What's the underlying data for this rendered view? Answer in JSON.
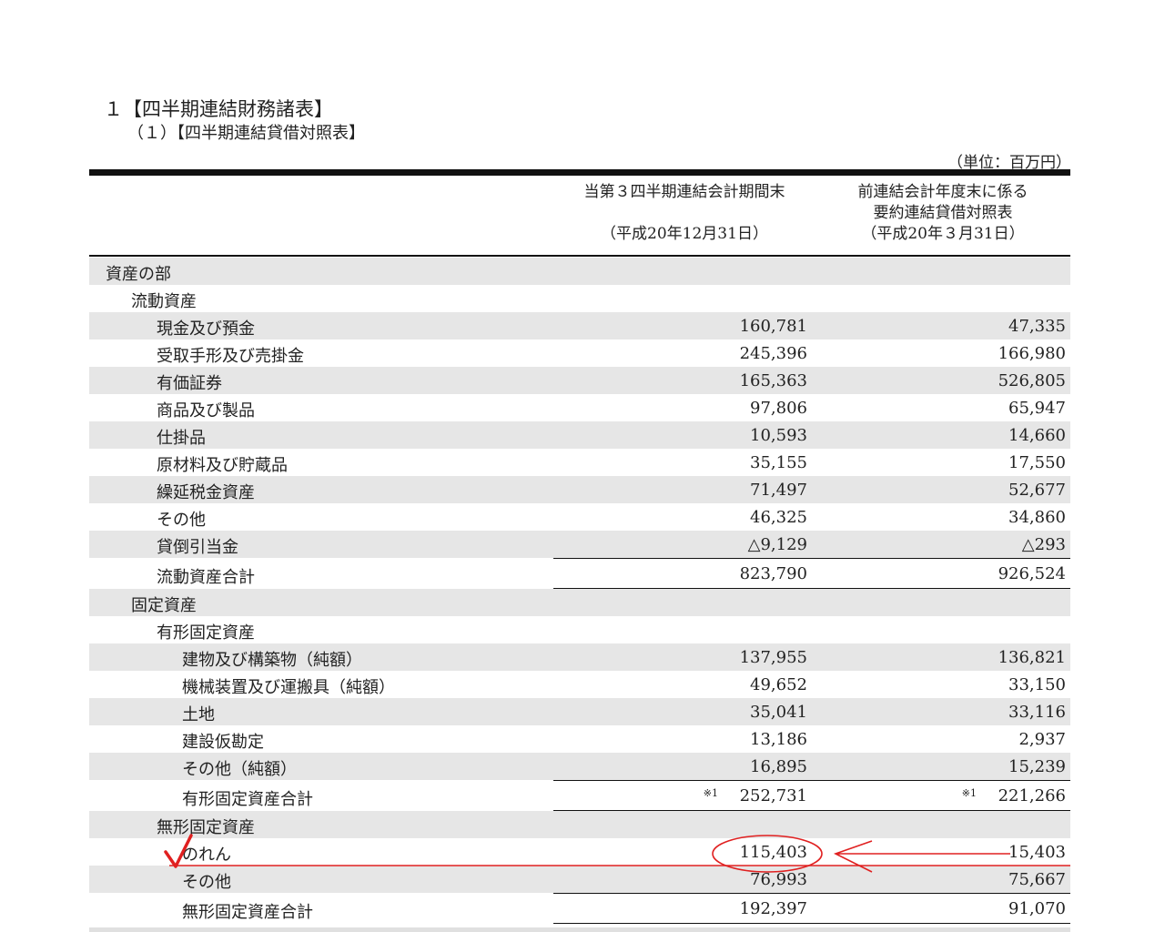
{
  "title": "１【四半期連結財務諸表】",
  "subtitle": "（１）【四半期連結貸借対照表】",
  "unit": "（単位：百万円）",
  "headers": {
    "current": [
      "当第３四半期連結会計期間末",
      "",
      "（平成20年12月31日）"
    ],
    "previous": [
      "前連結会計年度末に係る",
      "要約連結貸借対照表",
      "（平成20年３月31日）"
    ]
  },
  "rows": [
    {
      "label": "資産の部",
      "indent": 0,
      "shade": true
    },
    {
      "label": "流動資産",
      "indent": 1,
      "shade": false
    },
    {
      "label": "現金及び預金",
      "indent": 2,
      "shade": true,
      "cur": "160,781",
      "prev": "47,335"
    },
    {
      "label": "受取手形及び売掛金",
      "indent": 2,
      "shade": false,
      "cur": "245,396",
      "prev": "166,980"
    },
    {
      "label": "有価証券",
      "indent": 2,
      "shade": true,
      "cur": "165,363",
      "prev": "526,805"
    },
    {
      "label": "商品及び製品",
      "indent": 2,
      "shade": false,
      "cur": "97,806",
      "prev": "65,947"
    },
    {
      "label": "仕掛品",
      "indent": 2,
      "shade": true,
      "cur": "10,593",
      "prev": "14,660"
    },
    {
      "label": "原材料及び貯蔵品",
      "indent": 2,
      "shade": false,
      "cur": "35,155",
      "prev": "17,550"
    },
    {
      "label": "繰延税金資産",
      "indent": 2,
      "shade": true,
      "cur": "71,497",
      "prev": "52,677"
    },
    {
      "label": "その他",
      "indent": 2,
      "shade": false,
      "cur": "46,325",
      "prev": "34,860"
    },
    {
      "label": "貸倒引当金",
      "indent": 2,
      "shade": true,
      "cur": "△9,129",
      "prev": "△293"
    },
    {
      "label": "流動資産合計",
      "indent": 2,
      "shade": false,
      "cur": "823,790",
      "prev": "926,524",
      "total": true
    },
    {
      "label": "固定資産",
      "indent": 1,
      "shade": true
    },
    {
      "label": "有形固定資産",
      "indent": 2,
      "shade": false
    },
    {
      "label": "建物及び構築物（純額）",
      "indent": 3,
      "shade": true,
      "cur": "137,955",
      "prev": "136,821"
    },
    {
      "label": "機械装置及び運搬具（純額）",
      "indent": 3,
      "shade": false,
      "cur": "49,652",
      "prev": "33,150"
    },
    {
      "label": "土地",
      "indent": 3,
      "shade": true,
      "cur": "35,041",
      "prev": "33,116"
    },
    {
      "label": "建設仮勘定",
      "indent": 3,
      "shade": false,
      "cur": "13,186",
      "prev": "2,937"
    },
    {
      "label": "その他（純額）",
      "indent": 3,
      "shade": true,
      "cur": "16,895",
      "prev": "15,239"
    },
    {
      "label": "有形固定資産合計",
      "indent": 3,
      "shade": false,
      "cur": "252,731",
      "prev": "221,266",
      "total": true,
      "note_cur": "※1",
      "note_prev": "※1"
    },
    {
      "label": "無形固定資産",
      "indent": 2,
      "shade": true
    },
    {
      "label": "のれん",
      "indent": 3,
      "shade": false,
      "cur": "115,403",
      "prev": "15,403"
    },
    {
      "label": "その他",
      "indent": 3,
      "shade": true,
      "cur": "76,993",
      "prev": "75,667"
    },
    {
      "label": "無形固定資産合計",
      "indent": 3,
      "shade": false,
      "cur": "192,397",
      "prev": "91,070",
      "total": true
    }
  ],
  "annotation_color": "#e02020"
}
